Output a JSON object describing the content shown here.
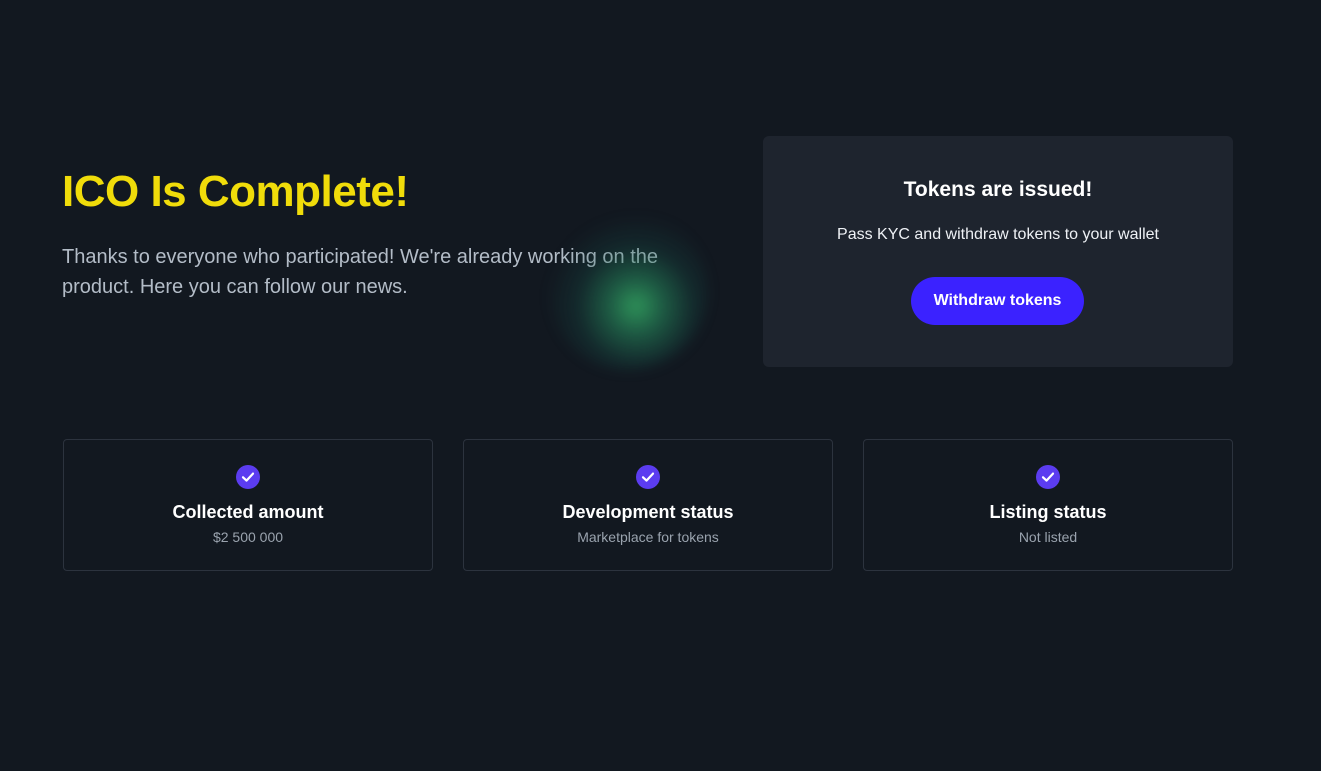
{
  "hero": {
    "title": "ICO Is Complete!",
    "text": "Thanks to everyone who participated! We're already working on the product. Here you can follow our news."
  },
  "kyc_panel": {
    "title": "Tokens are issued!",
    "text": "Pass KYC and withdraw tokens to your wallet",
    "button_label": "Withdraw tokens"
  },
  "status_cards": [
    {
      "title": "Collected amount",
      "value": "$2 500 000",
      "icon": "check-circle-icon"
    },
    {
      "title": "Development status",
      "value": "Marketplace for tokens",
      "icon": "check-circle-icon"
    },
    {
      "title": "Listing status",
      "value": "Not listed",
      "icon": "check-circle-icon"
    }
  ],
  "colors": {
    "background": "#121820",
    "title_yellow": "#f0dc0a",
    "button_blue": "#3b22ff",
    "check_purple": "#5b3cf0",
    "panel_bg": "#1e242e"
  }
}
